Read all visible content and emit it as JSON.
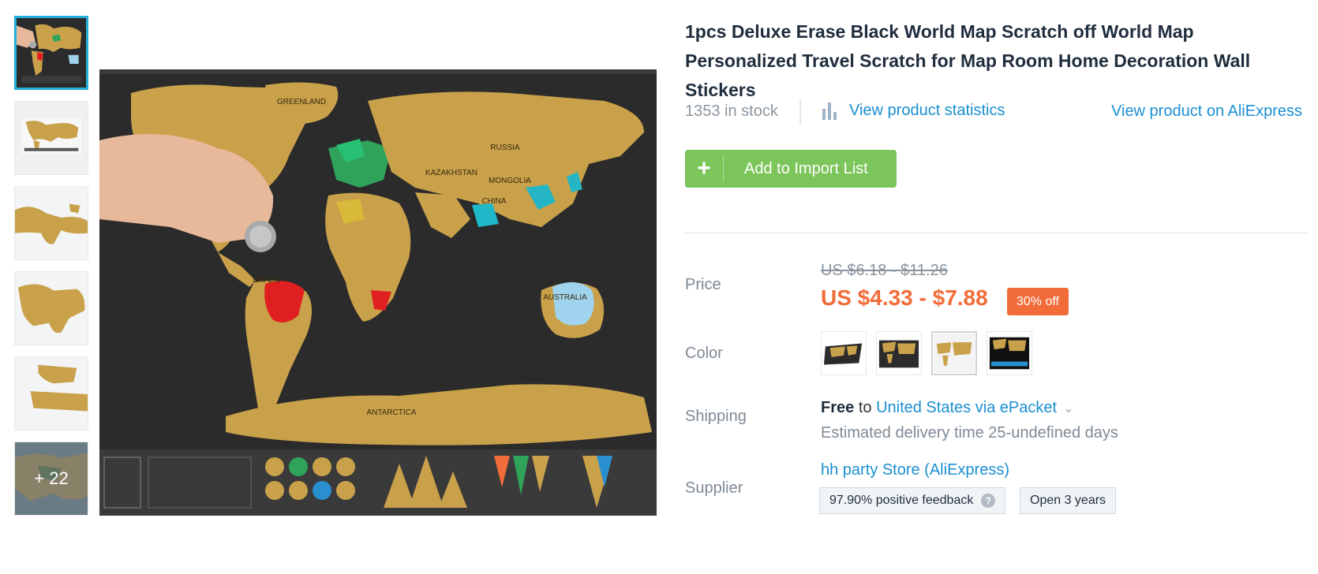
{
  "gallery": {
    "thumbnails": [
      {
        "alt": "scratch map with hand and coin"
      },
      {
        "alt": "scratch map overview"
      },
      {
        "alt": "map detail 1"
      },
      {
        "alt": "map detail 2"
      },
      {
        "alt": "map detail 3"
      },
      {
        "alt": "map detail 4"
      }
    ],
    "more_count": "+ 22"
  },
  "product": {
    "title": "1pcs Deluxe Erase Black World Map Scratch off World Map Personalized Travel Scratch for Map Room Home Decoration Wall Stickers",
    "stock": "1353 in stock",
    "stats_link": "View product statistics",
    "aliexpress_link": "View product on AliExpress",
    "add_button": "Add to Import List",
    "add_button_icon": "+",
    "price_label": "Price",
    "old_price": "US $6.18 - $11.26",
    "new_price": "US $4.33 - $7.88",
    "discount": "30% off",
    "color_label": "Color",
    "shipping_label": "Shipping",
    "shipping_cost": "Free",
    "shipping_to": "to",
    "shipping_dest": "United States via ePacket",
    "delivery": "Estimated delivery time 25-undefined days",
    "supplier_label": "Supplier",
    "supplier_name": "hh party Store (AliExpress)",
    "feedback": "97.90% positive feedback",
    "open_years": "Open 3 years",
    "feedback_help": "?"
  },
  "map_labels": {
    "greenland": "GREENLAND",
    "russia": "RUSSIA",
    "kazakhstan": "KAZAKHSTAN",
    "mongolia": "MONGOLIA",
    "china": "CHINA",
    "brazil": "BRAZIL",
    "australia": "AUSTRALIA",
    "antarctica": "ANTARCTICA"
  },
  "colors": {
    "accent": "#23b0d6",
    "link": "#1a8fd1",
    "sale": "#f26c3a",
    "button": "#7bc55a",
    "map_gold": "#c9a14a",
    "map_dark": "#2b2b2b"
  },
  "icons": {
    "stats": "bar-chart-icon",
    "dropdown": "chevron-down-icon",
    "help": "question-circle-icon",
    "add": "plus-icon"
  }
}
